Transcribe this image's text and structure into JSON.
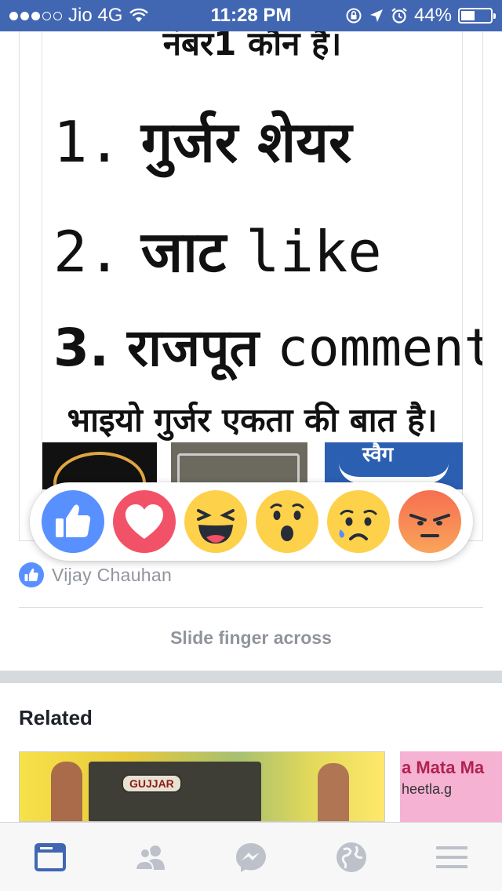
{
  "status_bar": {
    "carrier": "Jio 4G",
    "time": "11:28 PM",
    "battery": "44%",
    "signal_bars_filled": 3,
    "signal_bars_total": 5
  },
  "post_image": {
    "line0": "नंबर1 कौन है।",
    "line1_num": "1.",
    "line1_word": "गुर्जर शेयर",
    "line2_num": "2.",
    "line2_word": "जाट",
    "line2_action": "like",
    "line3_num": "3.",
    "line3_word": "राजपूत",
    "line3_action": "comment",
    "line4": "भाइयो गुर्जर एकता की बात है।",
    "strip_label": "स्वैग"
  },
  "reactions": [
    {
      "name": "like-reaction",
      "icon": "thumbs-up-icon",
      "color": "#5890ff"
    },
    {
      "name": "love-reaction",
      "icon": "heart-icon",
      "color": "#f25268"
    },
    {
      "name": "haha-reaction",
      "icon": "laughing-face-icon",
      "color": "#fed14b"
    },
    {
      "name": "wow-reaction",
      "icon": "surprised-face-icon",
      "color": "#fed14b"
    },
    {
      "name": "sad-reaction",
      "icon": "crying-face-icon",
      "color": "#fed14b"
    },
    {
      "name": "angry-reaction",
      "icon": "angry-face-icon",
      "color": "#f66f50"
    }
  ],
  "liker": {
    "name": "Vijay Chauhan",
    "icon": "like-badge-icon"
  },
  "hint": "Slide finger across",
  "related": {
    "title": "Related",
    "card1_badge": "GUJJAR",
    "card2_line1": "a Mata Ma",
    "card2_line2": "heetla.g"
  },
  "tab_bar": {
    "tabs": [
      {
        "name": "news-feed-tab",
        "icon": "news-feed-icon",
        "active": true
      },
      {
        "name": "friends-tab",
        "icon": "friends-icon",
        "active": false
      },
      {
        "name": "messenger-tab",
        "icon": "messenger-icon",
        "active": false
      },
      {
        "name": "notifications-tab",
        "icon": "globe-icon",
        "active": false
      },
      {
        "name": "menu-tab",
        "icon": "hamburger-menu-icon",
        "active": false
      }
    ]
  },
  "colors": {
    "brand_blue": "#4267b2",
    "active_tab": "#4267b2",
    "inactive_tab": "#bdc1c9",
    "muted_text": "#90949c"
  }
}
